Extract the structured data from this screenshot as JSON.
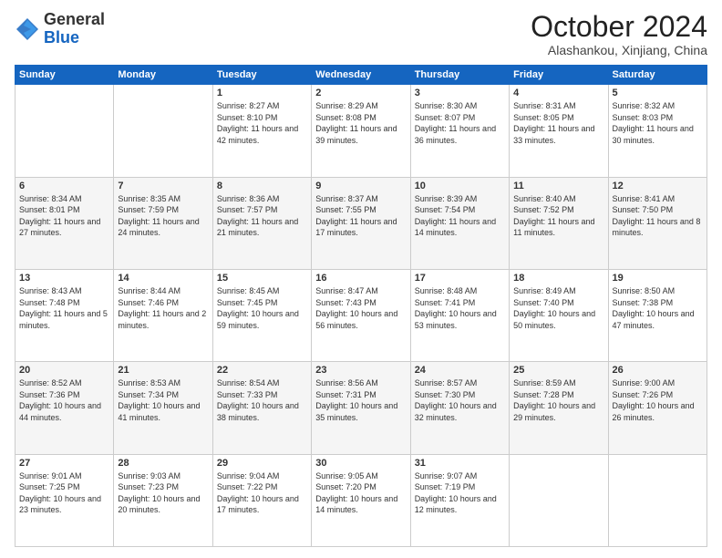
{
  "header": {
    "logo": {
      "line1": "General",
      "line2": "Blue"
    },
    "title": "October 2024",
    "subtitle": "Alashankou, Xinjiang, China"
  },
  "calendar": {
    "weekdays": [
      "Sunday",
      "Monday",
      "Tuesday",
      "Wednesday",
      "Thursday",
      "Friday",
      "Saturday"
    ],
    "weeks": [
      [
        {
          "day": "",
          "info": ""
        },
        {
          "day": "",
          "info": ""
        },
        {
          "day": "1",
          "info": "Sunrise: 8:27 AM\nSunset: 8:10 PM\nDaylight: 11 hours and 42 minutes."
        },
        {
          "day": "2",
          "info": "Sunrise: 8:29 AM\nSunset: 8:08 PM\nDaylight: 11 hours and 39 minutes."
        },
        {
          "day": "3",
          "info": "Sunrise: 8:30 AM\nSunset: 8:07 PM\nDaylight: 11 hours and 36 minutes."
        },
        {
          "day": "4",
          "info": "Sunrise: 8:31 AM\nSunset: 8:05 PM\nDaylight: 11 hours and 33 minutes."
        },
        {
          "day": "5",
          "info": "Sunrise: 8:32 AM\nSunset: 8:03 PM\nDaylight: 11 hours and 30 minutes."
        }
      ],
      [
        {
          "day": "6",
          "info": "Sunrise: 8:34 AM\nSunset: 8:01 PM\nDaylight: 11 hours and 27 minutes."
        },
        {
          "day": "7",
          "info": "Sunrise: 8:35 AM\nSunset: 7:59 PM\nDaylight: 11 hours and 24 minutes."
        },
        {
          "day": "8",
          "info": "Sunrise: 8:36 AM\nSunset: 7:57 PM\nDaylight: 11 hours and 21 minutes."
        },
        {
          "day": "9",
          "info": "Sunrise: 8:37 AM\nSunset: 7:55 PM\nDaylight: 11 hours and 17 minutes."
        },
        {
          "day": "10",
          "info": "Sunrise: 8:39 AM\nSunset: 7:54 PM\nDaylight: 11 hours and 14 minutes."
        },
        {
          "day": "11",
          "info": "Sunrise: 8:40 AM\nSunset: 7:52 PM\nDaylight: 11 hours and 11 minutes."
        },
        {
          "day": "12",
          "info": "Sunrise: 8:41 AM\nSunset: 7:50 PM\nDaylight: 11 hours and 8 minutes."
        }
      ],
      [
        {
          "day": "13",
          "info": "Sunrise: 8:43 AM\nSunset: 7:48 PM\nDaylight: 11 hours and 5 minutes."
        },
        {
          "day": "14",
          "info": "Sunrise: 8:44 AM\nSunset: 7:46 PM\nDaylight: 11 hours and 2 minutes."
        },
        {
          "day": "15",
          "info": "Sunrise: 8:45 AM\nSunset: 7:45 PM\nDaylight: 10 hours and 59 minutes."
        },
        {
          "day": "16",
          "info": "Sunrise: 8:47 AM\nSunset: 7:43 PM\nDaylight: 10 hours and 56 minutes."
        },
        {
          "day": "17",
          "info": "Sunrise: 8:48 AM\nSunset: 7:41 PM\nDaylight: 10 hours and 53 minutes."
        },
        {
          "day": "18",
          "info": "Sunrise: 8:49 AM\nSunset: 7:40 PM\nDaylight: 10 hours and 50 minutes."
        },
        {
          "day": "19",
          "info": "Sunrise: 8:50 AM\nSunset: 7:38 PM\nDaylight: 10 hours and 47 minutes."
        }
      ],
      [
        {
          "day": "20",
          "info": "Sunrise: 8:52 AM\nSunset: 7:36 PM\nDaylight: 10 hours and 44 minutes."
        },
        {
          "day": "21",
          "info": "Sunrise: 8:53 AM\nSunset: 7:34 PM\nDaylight: 10 hours and 41 minutes."
        },
        {
          "day": "22",
          "info": "Sunrise: 8:54 AM\nSunset: 7:33 PM\nDaylight: 10 hours and 38 minutes."
        },
        {
          "day": "23",
          "info": "Sunrise: 8:56 AM\nSunset: 7:31 PM\nDaylight: 10 hours and 35 minutes."
        },
        {
          "day": "24",
          "info": "Sunrise: 8:57 AM\nSunset: 7:30 PM\nDaylight: 10 hours and 32 minutes."
        },
        {
          "day": "25",
          "info": "Sunrise: 8:59 AM\nSunset: 7:28 PM\nDaylight: 10 hours and 29 minutes."
        },
        {
          "day": "26",
          "info": "Sunrise: 9:00 AM\nSunset: 7:26 PM\nDaylight: 10 hours and 26 minutes."
        }
      ],
      [
        {
          "day": "27",
          "info": "Sunrise: 9:01 AM\nSunset: 7:25 PM\nDaylight: 10 hours and 23 minutes."
        },
        {
          "day": "28",
          "info": "Sunrise: 9:03 AM\nSunset: 7:23 PM\nDaylight: 10 hours and 20 minutes."
        },
        {
          "day": "29",
          "info": "Sunrise: 9:04 AM\nSunset: 7:22 PM\nDaylight: 10 hours and 17 minutes."
        },
        {
          "day": "30",
          "info": "Sunrise: 9:05 AM\nSunset: 7:20 PM\nDaylight: 10 hours and 14 minutes."
        },
        {
          "day": "31",
          "info": "Sunrise: 9:07 AM\nSunset: 7:19 PM\nDaylight: 10 hours and 12 minutes."
        },
        {
          "day": "",
          "info": ""
        },
        {
          "day": "",
          "info": ""
        }
      ]
    ]
  }
}
